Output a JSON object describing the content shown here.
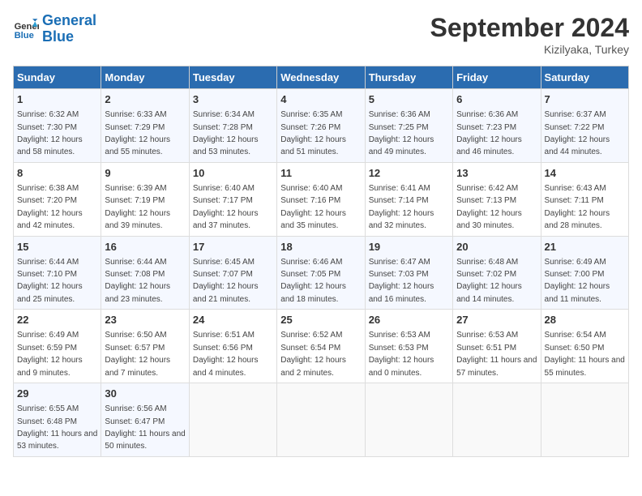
{
  "header": {
    "logo_line1": "General",
    "logo_line2": "Blue",
    "month": "September 2024",
    "location": "Kizilyaka, Turkey"
  },
  "weekdays": [
    "Sunday",
    "Monday",
    "Tuesday",
    "Wednesday",
    "Thursday",
    "Friday",
    "Saturday"
  ],
  "weeks": [
    [
      {
        "day": "1",
        "sunrise": "Sunrise: 6:32 AM",
        "sunset": "Sunset: 7:30 PM",
        "daylight": "Daylight: 12 hours and 58 minutes."
      },
      {
        "day": "2",
        "sunrise": "Sunrise: 6:33 AM",
        "sunset": "Sunset: 7:29 PM",
        "daylight": "Daylight: 12 hours and 55 minutes."
      },
      {
        "day": "3",
        "sunrise": "Sunrise: 6:34 AM",
        "sunset": "Sunset: 7:28 PM",
        "daylight": "Daylight: 12 hours and 53 minutes."
      },
      {
        "day": "4",
        "sunrise": "Sunrise: 6:35 AM",
        "sunset": "Sunset: 7:26 PM",
        "daylight": "Daylight: 12 hours and 51 minutes."
      },
      {
        "day": "5",
        "sunrise": "Sunrise: 6:36 AM",
        "sunset": "Sunset: 7:25 PM",
        "daylight": "Daylight: 12 hours and 49 minutes."
      },
      {
        "day": "6",
        "sunrise": "Sunrise: 6:36 AM",
        "sunset": "Sunset: 7:23 PM",
        "daylight": "Daylight: 12 hours and 46 minutes."
      },
      {
        "day": "7",
        "sunrise": "Sunrise: 6:37 AM",
        "sunset": "Sunset: 7:22 PM",
        "daylight": "Daylight: 12 hours and 44 minutes."
      }
    ],
    [
      {
        "day": "8",
        "sunrise": "Sunrise: 6:38 AM",
        "sunset": "Sunset: 7:20 PM",
        "daylight": "Daylight: 12 hours and 42 minutes."
      },
      {
        "day": "9",
        "sunrise": "Sunrise: 6:39 AM",
        "sunset": "Sunset: 7:19 PM",
        "daylight": "Daylight: 12 hours and 39 minutes."
      },
      {
        "day": "10",
        "sunrise": "Sunrise: 6:40 AM",
        "sunset": "Sunset: 7:17 PM",
        "daylight": "Daylight: 12 hours and 37 minutes."
      },
      {
        "day": "11",
        "sunrise": "Sunrise: 6:40 AM",
        "sunset": "Sunset: 7:16 PM",
        "daylight": "Daylight: 12 hours and 35 minutes."
      },
      {
        "day": "12",
        "sunrise": "Sunrise: 6:41 AM",
        "sunset": "Sunset: 7:14 PM",
        "daylight": "Daylight: 12 hours and 32 minutes."
      },
      {
        "day": "13",
        "sunrise": "Sunrise: 6:42 AM",
        "sunset": "Sunset: 7:13 PM",
        "daylight": "Daylight: 12 hours and 30 minutes."
      },
      {
        "day": "14",
        "sunrise": "Sunrise: 6:43 AM",
        "sunset": "Sunset: 7:11 PM",
        "daylight": "Daylight: 12 hours and 28 minutes."
      }
    ],
    [
      {
        "day": "15",
        "sunrise": "Sunrise: 6:44 AM",
        "sunset": "Sunset: 7:10 PM",
        "daylight": "Daylight: 12 hours and 25 minutes."
      },
      {
        "day": "16",
        "sunrise": "Sunrise: 6:44 AM",
        "sunset": "Sunset: 7:08 PM",
        "daylight": "Daylight: 12 hours and 23 minutes."
      },
      {
        "day": "17",
        "sunrise": "Sunrise: 6:45 AM",
        "sunset": "Sunset: 7:07 PM",
        "daylight": "Daylight: 12 hours and 21 minutes."
      },
      {
        "day": "18",
        "sunrise": "Sunrise: 6:46 AM",
        "sunset": "Sunset: 7:05 PM",
        "daylight": "Daylight: 12 hours and 18 minutes."
      },
      {
        "day": "19",
        "sunrise": "Sunrise: 6:47 AM",
        "sunset": "Sunset: 7:03 PM",
        "daylight": "Daylight: 12 hours and 16 minutes."
      },
      {
        "day": "20",
        "sunrise": "Sunrise: 6:48 AM",
        "sunset": "Sunset: 7:02 PM",
        "daylight": "Daylight: 12 hours and 14 minutes."
      },
      {
        "day": "21",
        "sunrise": "Sunrise: 6:49 AM",
        "sunset": "Sunset: 7:00 PM",
        "daylight": "Daylight: 12 hours and 11 minutes."
      }
    ],
    [
      {
        "day": "22",
        "sunrise": "Sunrise: 6:49 AM",
        "sunset": "Sunset: 6:59 PM",
        "daylight": "Daylight: 12 hours and 9 minutes."
      },
      {
        "day": "23",
        "sunrise": "Sunrise: 6:50 AM",
        "sunset": "Sunset: 6:57 PM",
        "daylight": "Daylight: 12 hours and 7 minutes."
      },
      {
        "day": "24",
        "sunrise": "Sunrise: 6:51 AM",
        "sunset": "Sunset: 6:56 PM",
        "daylight": "Daylight: 12 hours and 4 minutes."
      },
      {
        "day": "25",
        "sunrise": "Sunrise: 6:52 AM",
        "sunset": "Sunset: 6:54 PM",
        "daylight": "Daylight: 12 hours and 2 minutes."
      },
      {
        "day": "26",
        "sunrise": "Sunrise: 6:53 AM",
        "sunset": "Sunset: 6:53 PM",
        "daylight": "Daylight: 12 hours and 0 minutes."
      },
      {
        "day": "27",
        "sunrise": "Sunrise: 6:53 AM",
        "sunset": "Sunset: 6:51 PM",
        "daylight": "Daylight: 11 hours and 57 minutes."
      },
      {
        "day": "28",
        "sunrise": "Sunrise: 6:54 AM",
        "sunset": "Sunset: 6:50 PM",
        "daylight": "Daylight: 11 hours and 55 minutes."
      }
    ],
    [
      {
        "day": "29",
        "sunrise": "Sunrise: 6:55 AM",
        "sunset": "Sunset: 6:48 PM",
        "daylight": "Daylight: 11 hours and 53 minutes."
      },
      {
        "day": "30",
        "sunrise": "Sunrise: 6:56 AM",
        "sunset": "Sunset: 6:47 PM",
        "daylight": "Daylight: 11 hours and 50 minutes."
      },
      {
        "day": "",
        "sunrise": "",
        "sunset": "",
        "daylight": ""
      },
      {
        "day": "",
        "sunrise": "",
        "sunset": "",
        "daylight": ""
      },
      {
        "day": "",
        "sunrise": "",
        "sunset": "",
        "daylight": ""
      },
      {
        "day": "",
        "sunrise": "",
        "sunset": "",
        "daylight": ""
      },
      {
        "day": "",
        "sunrise": "",
        "sunset": "",
        "daylight": ""
      }
    ]
  ]
}
